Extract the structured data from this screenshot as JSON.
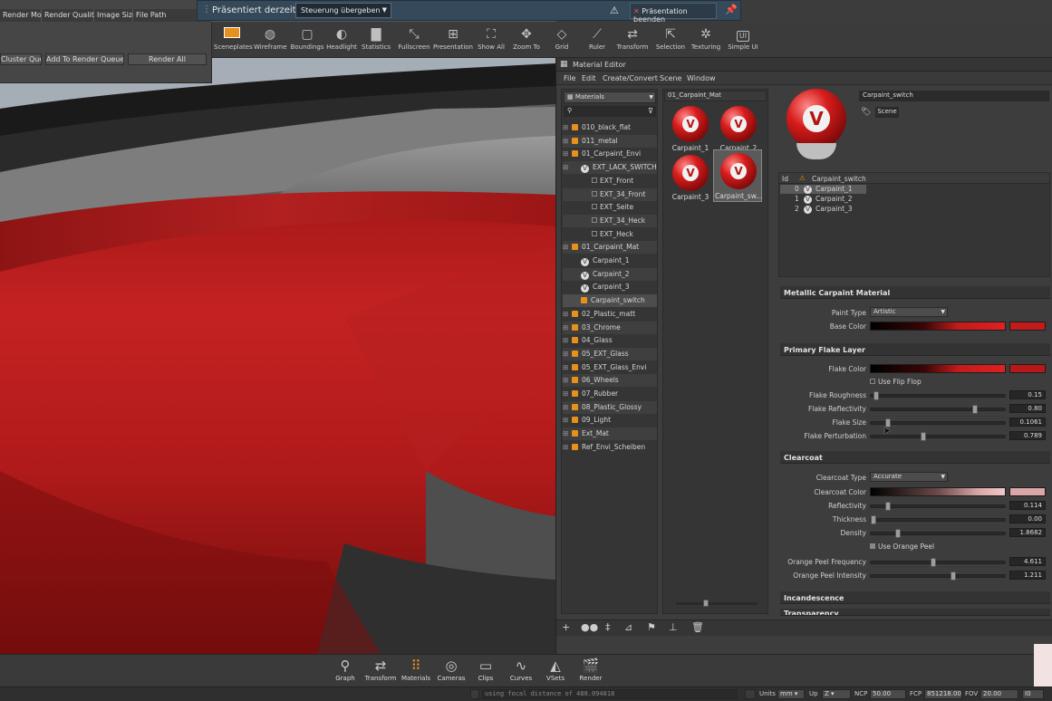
{
  "render_queue": {
    "columns": [
      "Render Mode",
      "Render Quality",
      "Image Size",
      "File Path"
    ],
    "buttons": [
      "Cluster Queue",
      "Add To Render Queue",
      "Render All"
    ]
  },
  "presentation": {
    "title": "Präsentiert derzeit",
    "control_select": "Steuerung übergeben",
    "end_button": "Präsentation beenden"
  },
  "toolbar": {
    "items": [
      "Sceneplates",
      "Wireframe",
      "Boundings",
      "Headlight",
      "Statistics",
      "Fullscreen",
      "Presentation",
      "Show All",
      "Zoom To",
      "Grid",
      "Ruler",
      "Transform",
      "Selection",
      "Texturing",
      "Simple UI"
    ],
    "simple_ui_icon_text": "UI"
  },
  "material_editor": {
    "title": "Material Editor",
    "menu": [
      "File",
      "Edit",
      "Create/Convert",
      "Scene",
      "Window"
    ],
    "tree_header": "Materials",
    "tree": [
      {
        "label": "010_black_flat",
        "kind": "mat"
      },
      {
        "label": "011_metal",
        "kind": "mat"
      },
      {
        "label": "01_Carpaint_Envi",
        "kind": "mat"
      },
      {
        "label": "EXT_LACK_SWITCH",
        "kind": "switch"
      },
      {
        "label": "EXT_Front",
        "kind": "item"
      },
      {
        "label": "EXT_34_Front",
        "kind": "item"
      },
      {
        "label": "EXT_Seite",
        "kind": "item"
      },
      {
        "label": "EXT_34_Heck",
        "kind": "item"
      },
      {
        "label": "EXT_Heck",
        "kind": "item"
      },
      {
        "label": "01_Carpaint_Mat",
        "kind": "mat"
      },
      {
        "label": "Carpaint_1",
        "kind": "sw"
      },
      {
        "label": "Carpaint_2",
        "kind": "sw"
      },
      {
        "label": "Carpaint_3",
        "kind": "sw"
      },
      {
        "label": "Carpaint_switch",
        "kind": "sel"
      },
      {
        "label": "02_Plastic_matt",
        "kind": "mat"
      },
      {
        "label": "03_Chrome",
        "kind": "mat"
      },
      {
        "label": "04_Glass",
        "kind": "mat"
      },
      {
        "label": "05_EXT_Glass",
        "kind": "mat"
      },
      {
        "label": "05_EXT_Glass_Envi",
        "kind": "mat"
      },
      {
        "label": "06_Wheels",
        "kind": "mat"
      },
      {
        "label": "07_Rubber",
        "kind": "mat"
      },
      {
        "label": "08_Plastic_Glossy",
        "kind": "mat"
      },
      {
        "label": "09_Light",
        "kind": "mat"
      },
      {
        "label": "Ext_Mat",
        "kind": "mat"
      },
      {
        "label": "Ref_Envi_Scheiben",
        "kind": "mat"
      }
    ],
    "thumb_header": "01_Carpaint_Mat",
    "thumbnails": [
      "Carpaint_1",
      "Carpaint_2",
      "Carpaint_3",
      "Carpaint_sw..."
    ],
    "material_name": "Carpaint_switch",
    "scene_button": "Scene",
    "switch_list": {
      "col_id": "Id",
      "col_name": "Carpaint_switch",
      "rows": [
        {
          "id": "0",
          "name": "Carpaint_1"
        },
        {
          "id": "1",
          "name": "Carpaint_2"
        },
        {
          "id": "2",
          "name": "Carpaint_3"
        }
      ]
    },
    "sections": {
      "metallic": "Metallic Carpaint Material",
      "flake": "Primary Flake Layer",
      "clearcoat": "Clearcoat",
      "incandescence": "Incandescence",
      "transparency": "Transparency"
    },
    "paint_type_label": "Paint Type",
    "paint_type": "Artistic",
    "base_color_label": "Base Color",
    "flake_color_label": "Flake Color",
    "use_flip_flop": "Use Flip Flop",
    "flake_props": [
      {
        "label": "Flake Roughness",
        "value": "0.15",
        "level": 0.02
      },
      {
        "label": "Flake Reflectivity",
        "value": "0.80",
        "level": 0.78
      },
      {
        "label": "Flake Size",
        "value": "0.1061",
        "level": 0.11
      },
      {
        "label": "Flake Perturbation",
        "value": "0.789",
        "level": 0.38
      }
    ],
    "clearcoat_type_label": "Clearcoat Type",
    "clearcoat_type": "Accurate",
    "clearcoat_color_label": "Clearcoat Color",
    "clearcoat_props": [
      {
        "label": "Reflectivity",
        "value": "0.114",
        "level": 0.11
      },
      {
        "label": "Thickness",
        "value": "0.00",
        "level": 0.0
      },
      {
        "label": "Density",
        "value": "1.8682",
        "level": 0.19
      }
    ],
    "use_orange_peel": "Use Orange Peel",
    "orange_props": [
      {
        "label": "Orange Peel Frequency",
        "value": "4.611",
        "level": 0.46
      },
      {
        "label": "Orange Peel Intensity",
        "value": "1.211",
        "level": 0.61
      }
    ]
  },
  "bottom_modules": [
    "Graph",
    "Transform",
    "Materials",
    "Cameras",
    "Clips",
    "Curves",
    "VSets",
    "Render"
  ],
  "status_bar": {
    "message": "using focal distance of 488.094818",
    "units_label": "Units",
    "units": "mm",
    "up_label": "Up",
    "up": "Z",
    "ncp_label": "NCP",
    "ncp": "50.00",
    "fcp_label": "FCP",
    "fcp": "851218.00",
    "fov_label": "FOV",
    "fov": "20.00",
    "extra": "I0"
  },
  "colors": {
    "accent_orange": "#e8901c",
    "carpaint_red": "#c21b1b",
    "presentation_bar": "#34495a"
  }
}
